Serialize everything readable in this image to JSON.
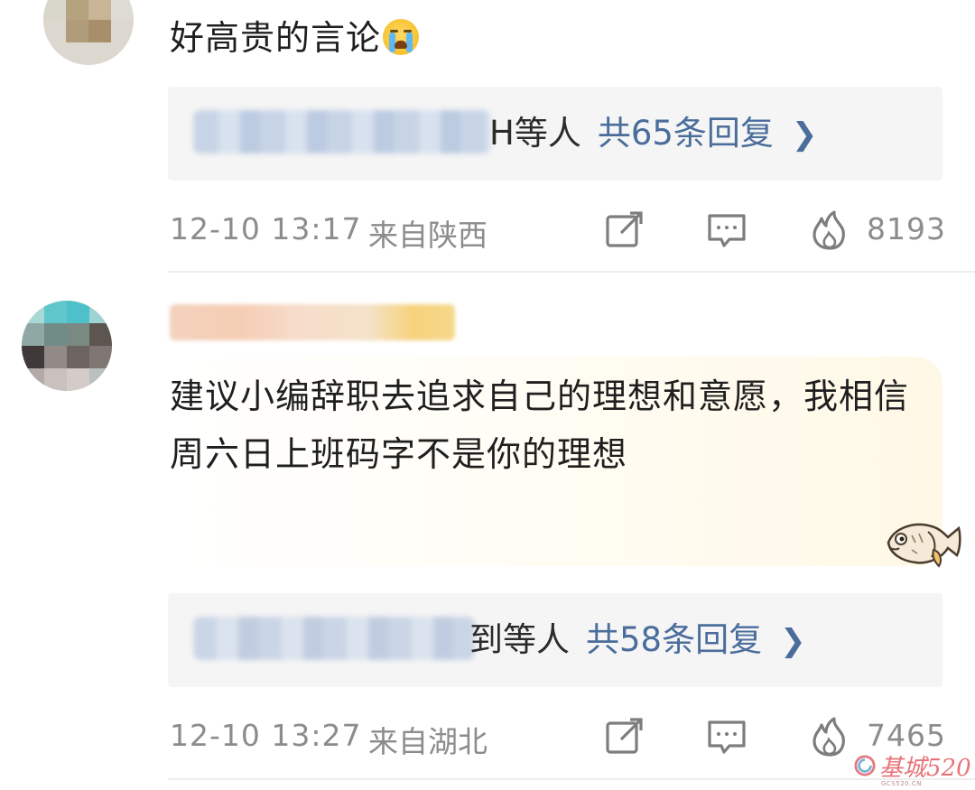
{
  "comments": [
    {
      "text": "好高贵的言论",
      "emoji": "crying-face-emoji",
      "reply_suffix": "H等人",
      "reply_count": "共65条回复",
      "time": "12-10 13:17",
      "location": "来自陕西",
      "likes": "8193"
    },
    {
      "text": "建议小编辞职去追求自己的理想和意愿，我相信周六日上班码字不是你的理想",
      "reply_suffix": "到等人",
      "reply_count": "共58条回复",
      "time": "12-10 13:27",
      "location": "来自湖北",
      "likes": "7465"
    }
  ],
  "icons": {
    "share": "share-edit-icon",
    "comment": "comment-bubble-icon",
    "like": "fire-icon",
    "chevron": "chevron-right-icon",
    "sticker": "fish-sticker"
  },
  "watermark": {
    "text": "基城520",
    "sub": "GCS520.CN"
  },
  "colors": {
    "link": "#4a6d9b",
    "meta": "#8c8c8c",
    "reply_bg": "#f5f5f5"
  }
}
